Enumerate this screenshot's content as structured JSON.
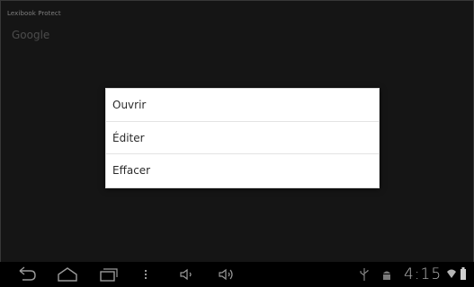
{
  "app": {
    "title": "Lexibook Protect",
    "subtitle": "Google"
  },
  "context_menu": {
    "items": [
      {
        "label": "Ouvrir"
      },
      {
        "label": "Éditer"
      },
      {
        "label": "Effacer"
      }
    ]
  },
  "navigation_bar": {
    "buttons": [
      "back-icon",
      "home-icon",
      "recent-apps-icon",
      "menu-dots-icon",
      "volume-down-icon",
      "volume-up-icon"
    ],
    "status": {
      "icons": [
        "usb-icon",
        "android-debug-icon",
        "wifi-icon",
        "battery-icon"
      ],
      "time": "4:15"
    }
  },
  "colors": {
    "background": "#1a1a1a",
    "menu_background": "#ffffff",
    "menu_text": "#2b2b2b",
    "navbar_background": "#000000",
    "icon_color": "#9a9a9a"
  }
}
